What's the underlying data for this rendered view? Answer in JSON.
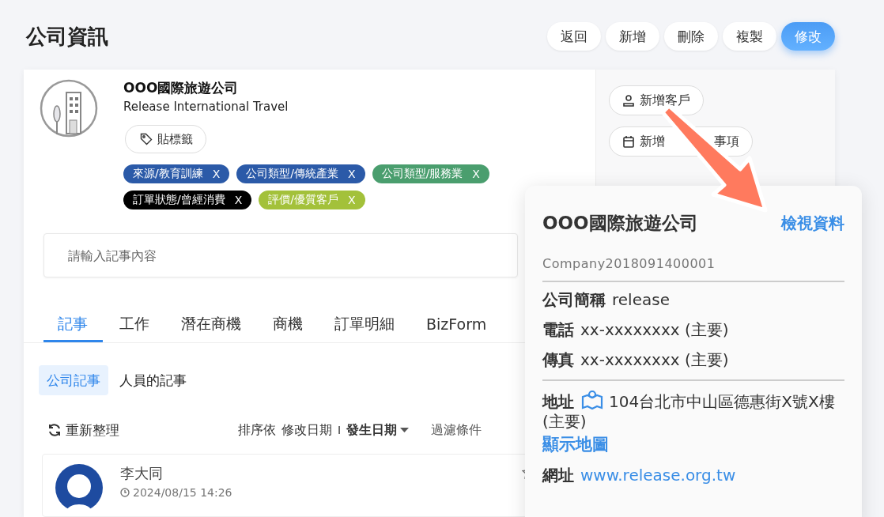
{
  "page": {
    "title": "公司資訊"
  },
  "actions": [
    {
      "label": "返回",
      "primary": false
    },
    {
      "label": "新增",
      "primary": false
    },
    {
      "label": "刪除",
      "primary": false
    },
    {
      "label": "複製",
      "primary": false
    },
    {
      "label": "修改",
      "primary": true
    }
  ],
  "company": {
    "name": "OOO國際旅遊公司",
    "english_name": "Release International Travel",
    "tag_button": "貼標籤"
  },
  "tags": [
    {
      "label": "來源/教育訓練",
      "remove": "X",
      "color": "#2b5aa8"
    },
    {
      "label": "公司類型/傳統產業",
      "remove": "X",
      "color": "#2b5aa8"
    },
    {
      "label": "公司類型/服務業",
      "remove": "X",
      "color": "#4a9e6e"
    },
    {
      "label": "訂單狀態/曾經消費",
      "remove": "X",
      "color": "#000000"
    },
    {
      "label": "評價/優質客戶",
      "remove": "X",
      "color": "#a3c13a"
    }
  ],
  "side_buttons": [
    {
      "kind": "person",
      "label": "新增客戶"
    },
    {
      "kind": "calendar",
      "label": "新增",
      "label_end": "事項"
    }
  ],
  "note_input": {
    "placeholder": "請輸入記事內容"
  },
  "tabs": [
    {
      "label": "記事",
      "selected": true
    },
    {
      "label": "工作",
      "selected": false
    },
    {
      "label": "潛在商機",
      "selected": false
    },
    {
      "label": "商機",
      "selected": false
    },
    {
      "label": "訂單明細",
      "selected": false
    },
    {
      "label": "BizForm",
      "selected": false
    }
  ],
  "subtabs": [
    {
      "label": "公司記事",
      "selected": true
    },
    {
      "label": "人員的記事",
      "selected": false
    }
  ],
  "toolbar": {
    "refresh": "重新整理",
    "sort_label": "排序依",
    "sort_options": [
      {
        "label": "修改日期",
        "selected": false
      },
      {
        "label": "發生日期",
        "selected": true
      }
    ],
    "separator": "I",
    "filter": "過濾條件"
  },
  "notes": [
    {
      "author": "李大同",
      "time": "2024/08/15 14:26"
    }
  ],
  "popup": {
    "title": "OOO國際旅遊公司",
    "link": "檢視資料",
    "code": "Company2018091400001",
    "groups": [
      [
        {
          "label": "公司簡稱",
          "value": "release"
        },
        {
          "label": "電話",
          "value": "xx-xxxxxxxx (主要)"
        },
        {
          "label": "傳真",
          "value": "xx-xxxxxxxx (主要)"
        }
      ],
      [
        {
          "label": "地址",
          "kind": "address",
          "value": "104台北市中山區德惠街X號X樓 (主要)",
          "extra_link": "顯示地圖"
        },
        {
          "label": "網址",
          "kind": "link",
          "value": "www.release.org.tw"
        }
      ]
    ]
  }
}
